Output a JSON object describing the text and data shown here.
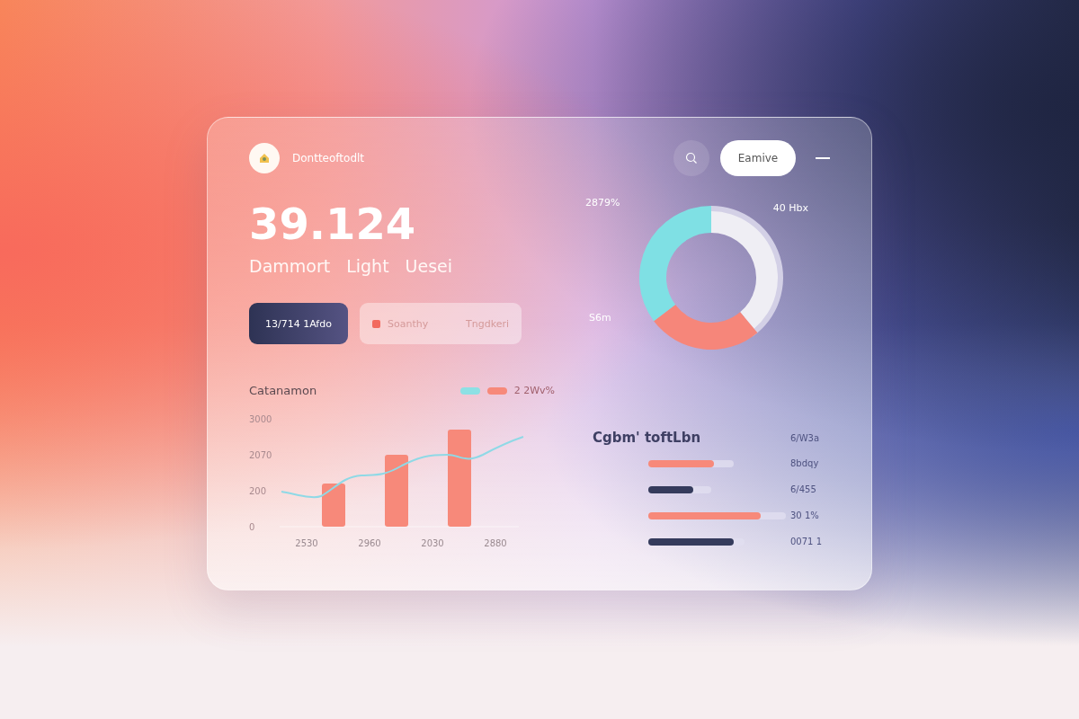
{
  "header": {
    "title": "Dontteoftodlt",
    "action_button": "Eamive"
  },
  "headline": {
    "value": "39.124",
    "labels": [
      "Dammort",
      "Light",
      "Uesei"
    ]
  },
  "buttons": [
    {
      "label": "13/714 1Afdo",
      "kind": "primary"
    },
    {
      "label": "Soanthy",
      "secondary_label": "Tngdkeri",
      "kind": "secondary"
    }
  ],
  "donut": {
    "labels": [
      "2879%",
      "40 Hbx",
      "S6m"
    ]
  },
  "chart": {
    "title": "Catanamon",
    "legend": "2 2Wv%",
    "y_axis_labels": [
      "3000",
      "2070",
      "200",
      "0"
    ],
    "x_axis_labels": [
      "2530",
      "2960",
      "2030",
      "2880"
    ]
  },
  "breakdown": {
    "title": "Cgbm' toftLbn",
    "title_value": "6/W3a",
    "rows": [
      {
        "kind": "coral",
        "level": 0.77,
        "value": "8bdqy"
      },
      {
        "kind": "navy",
        "level": 0.71,
        "value": "6/455"
      },
      {
        "kind": "coral",
        "level": 0.82,
        "value": "30 1%"
      },
      {
        "kind": "navy",
        "level": 0.89,
        "value": "0071 1"
      }
    ]
  }
}
